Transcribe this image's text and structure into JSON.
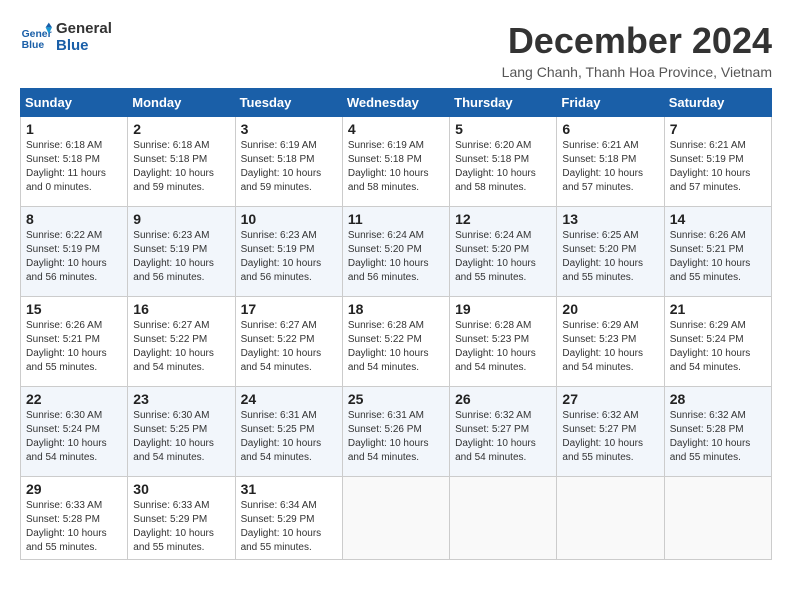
{
  "header": {
    "logo_line1": "General",
    "logo_line2": "Blue",
    "title": "December 2024",
    "location": "Lang Chanh, Thanh Hoa Province, Vietnam"
  },
  "days_of_week": [
    "Sunday",
    "Monday",
    "Tuesday",
    "Wednesday",
    "Thursday",
    "Friday",
    "Saturday"
  ],
  "weeks": [
    [
      {
        "day": 1,
        "sunrise": "6:18 AM",
        "sunset": "5:18 PM",
        "daylight": "11 hours and 0 minutes."
      },
      {
        "day": 2,
        "sunrise": "6:18 AM",
        "sunset": "5:18 PM",
        "daylight": "10 hours and 59 minutes."
      },
      {
        "day": 3,
        "sunrise": "6:19 AM",
        "sunset": "5:18 PM",
        "daylight": "10 hours and 59 minutes."
      },
      {
        "day": 4,
        "sunrise": "6:19 AM",
        "sunset": "5:18 PM",
        "daylight": "10 hours and 58 minutes."
      },
      {
        "day": 5,
        "sunrise": "6:20 AM",
        "sunset": "5:18 PM",
        "daylight": "10 hours and 58 minutes."
      },
      {
        "day": 6,
        "sunrise": "6:21 AM",
        "sunset": "5:18 PM",
        "daylight": "10 hours and 57 minutes."
      },
      {
        "day": 7,
        "sunrise": "6:21 AM",
        "sunset": "5:19 PM",
        "daylight": "10 hours and 57 minutes."
      }
    ],
    [
      {
        "day": 8,
        "sunrise": "6:22 AM",
        "sunset": "5:19 PM",
        "daylight": "10 hours and 56 minutes."
      },
      {
        "day": 9,
        "sunrise": "6:23 AM",
        "sunset": "5:19 PM",
        "daylight": "10 hours and 56 minutes."
      },
      {
        "day": 10,
        "sunrise": "6:23 AM",
        "sunset": "5:19 PM",
        "daylight": "10 hours and 56 minutes."
      },
      {
        "day": 11,
        "sunrise": "6:24 AM",
        "sunset": "5:20 PM",
        "daylight": "10 hours and 56 minutes."
      },
      {
        "day": 12,
        "sunrise": "6:24 AM",
        "sunset": "5:20 PM",
        "daylight": "10 hours and 55 minutes."
      },
      {
        "day": 13,
        "sunrise": "6:25 AM",
        "sunset": "5:20 PM",
        "daylight": "10 hours and 55 minutes."
      },
      {
        "day": 14,
        "sunrise": "6:26 AM",
        "sunset": "5:21 PM",
        "daylight": "10 hours and 55 minutes."
      }
    ],
    [
      {
        "day": 15,
        "sunrise": "6:26 AM",
        "sunset": "5:21 PM",
        "daylight": "10 hours and 55 minutes."
      },
      {
        "day": 16,
        "sunrise": "6:27 AM",
        "sunset": "5:22 PM",
        "daylight": "10 hours and 54 minutes."
      },
      {
        "day": 17,
        "sunrise": "6:27 AM",
        "sunset": "5:22 PM",
        "daylight": "10 hours and 54 minutes."
      },
      {
        "day": 18,
        "sunrise": "6:28 AM",
        "sunset": "5:22 PM",
        "daylight": "10 hours and 54 minutes."
      },
      {
        "day": 19,
        "sunrise": "6:28 AM",
        "sunset": "5:23 PM",
        "daylight": "10 hours and 54 minutes."
      },
      {
        "day": 20,
        "sunrise": "6:29 AM",
        "sunset": "5:23 PM",
        "daylight": "10 hours and 54 minutes."
      },
      {
        "day": 21,
        "sunrise": "6:29 AM",
        "sunset": "5:24 PM",
        "daylight": "10 hours and 54 minutes."
      }
    ],
    [
      {
        "day": 22,
        "sunrise": "6:30 AM",
        "sunset": "5:24 PM",
        "daylight": "10 hours and 54 minutes."
      },
      {
        "day": 23,
        "sunrise": "6:30 AM",
        "sunset": "5:25 PM",
        "daylight": "10 hours and 54 minutes."
      },
      {
        "day": 24,
        "sunrise": "6:31 AM",
        "sunset": "5:25 PM",
        "daylight": "10 hours and 54 minutes."
      },
      {
        "day": 25,
        "sunrise": "6:31 AM",
        "sunset": "5:26 PM",
        "daylight": "10 hours and 54 minutes."
      },
      {
        "day": 26,
        "sunrise": "6:32 AM",
        "sunset": "5:27 PM",
        "daylight": "10 hours and 54 minutes."
      },
      {
        "day": 27,
        "sunrise": "6:32 AM",
        "sunset": "5:27 PM",
        "daylight": "10 hours and 55 minutes."
      },
      {
        "day": 28,
        "sunrise": "6:32 AM",
        "sunset": "5:28 PM",
        "daylight": "10 hours and 55 minutes."
      }
    ],
    [
      {
        "day": 29,
        "sunrise": "6:33 AM",
        "sunset": "5:28 PM",
        "daylight": "10 hours and 55 minutes."
      },
      {
        "day": 30,
        "sunrise": "6:33 AM",
        "sunset": "5:29 PM",
        "daylight": "10 hours and 55 minutes."
      },
      {
        "day": 31,
        "sunrise": "6:34 AM",
        "sunset": "5:29 PM",
        "daylight": "10 hours and 55 minutes."
      },
      null,
      null,
      null,
      null
    ]
  ],
  "labels": {
    "sunrise": "Sunrise:",
    "sunset": "Sunset:",
    "daylight": "Daylight:"
  }
}
